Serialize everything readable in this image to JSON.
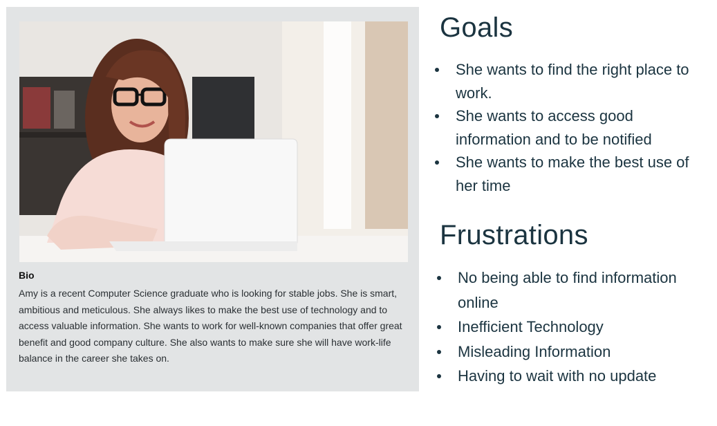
{
  "bio": {
    "title": "Bio",
    "text": "Amy is a recent Computer Science graduate who is looking for stable jobs. She is smart, ambitious and meticulous. She always likes to make the best use of technology and to access valuable information. She wants to work for well-known companies that offer great benefit and good company culture. She also wants to make sure she will have work-life balance in the career she takes on."
  },
  "goals": {
    "title": "Goals",
    "items": [
      "She wants to find the right place to work.",
      "She wants to access good information and to be notified",
      "She wants to make the best use of her time"
    ]
  },
  "frustrations": {
    "title": "Frustrations",
    "items": [
      "No being able to find information online",
      "Inefficient Technology",
      "Misleading Information",
      "Having to wait with no update"
    ]
  }
}
